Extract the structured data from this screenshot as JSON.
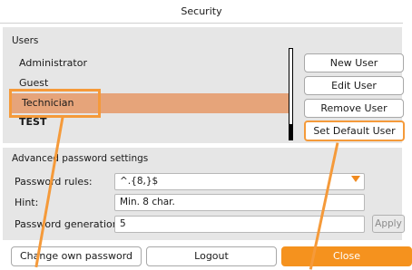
{
  "window": {
    "title": "Security"
  },
  "users": {
    "section_label": "Users",
    "items": [
      {
        "name": "Administrator"
      },
      {
        "name": "Guest"
      },
      {
        "name": "Technician"
      },
      {
        "name": "TEST"
      }
    ],
    "selected": "Technician"
  },
  "user_buttons": {
    "new_user": "New User",
    "edit_user": "Edit User",
    "remove_user": "Remove User",
    "set_default_user": "Set Default User"
  },
  "password_settings": {
    "section_label": "Advanced password settings",
    "rules_label": "Password rules:",
    "rules_value": "^.{8,}$",
    "hint_label": "Hint:",
    "hint_value": "Min. 8 char.",
    "generations_label": "Password generations:",
    "generations_value": "5",
    "apply_label": "Apply"
  },
  "bottom_buttons": {
    "change_password": "Change own password",
    "logout": "Logout",
    "close": "Close"
  },
  "colors": {
    "accent": "#f5921e",
    "selection": "#e6a47a",
    "callout": "#f59a3a",
    "panel": "#e6e6e6"
  }
}
